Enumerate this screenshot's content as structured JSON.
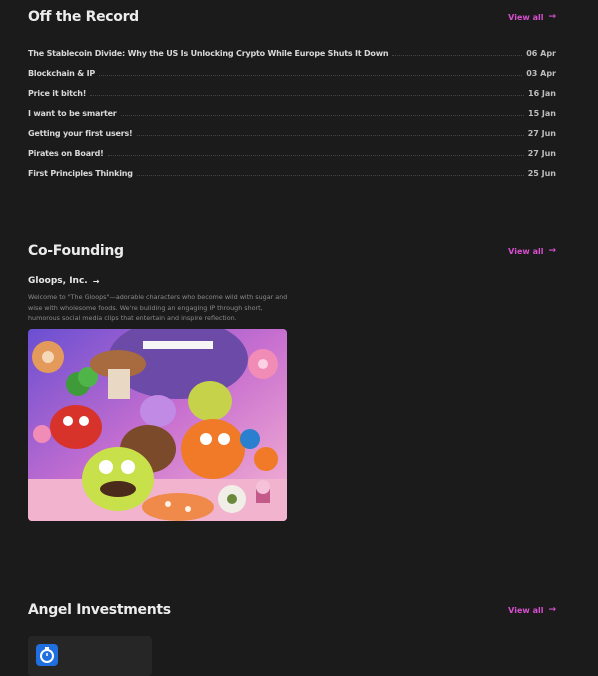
{
  "off_the_record": {
    "title": "Off the Record",
    "view_all": "View all",
    "posts": [
      {
        "title": "The Stablecoin Divide: Why the US Is Unlocking Crypto While Europe Shuts It Down",
        "date": "06 Apr"
      },
      {
        "title": "Blockchain & IP",
        "date": "03 Apr"
      },
      {
        "title": "Price it bitch!",
        "date": "16 Jan"
      },
      {
        "title": "I want to be smarter",
        "date": "15 Jan"
      },
      {
        "title": "Getting your first users!",
        "date": "27 Jun"
      },
      {
        "title": "Pirates on Board!",
        "date": "27 Jun"
      },
      {
        "title": "First Principles Thinking",
        "date": "25 Jun"
      }
    ]
  },
  "co_founding": {
    "title": "Co-Founding",
    "view_all": "View all",
    "company": {
      "name": "Gloops, Inc.",
      "description": "Welcome to \"The Gloops\"—adorable characters who become wild with sugar and wise with wholesome foods. We're building an engaging IP through short, humorous social media clips that entertain and inspire reflection."
    }
  },
  "angel_investments": {
    "title": "Angel Investments",
    "view_all": "View all"
  },
  "colors": {
    "background": "#1b1b1b",
    "accent": "#d84fd0",
    "text": "#e6e6e6",
    "muted": "#8a8a8a"
  },
  "icons": [
    "arrow-right-icon",
    "company-logo-icon"
  ]
}
